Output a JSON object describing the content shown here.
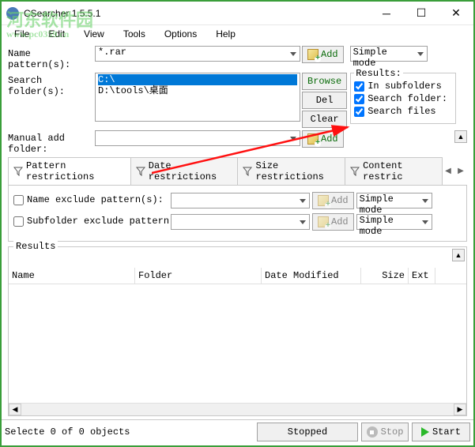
{
  "window": {
    "title": "CSearcher 1.5.5.1"
  },
  "menu": {
    "file": "File",
    "edit": "Edit",
    "view": "View",
    "tools": "Tools",
    "options": "Options",
    "help": "Help"
  },
  "watermark": {
    "line1": "河东软件园",
    "line2": "www.pc0359.cn"
  },
  "form": {
    "name_pattern_label": "Name pattern(s):",
    "name_pattern_value": "*.rar",
    "add_label": "Add",
    "simple_mode": "Simple mode",
    "search_folder_label": "Search folder(s):",
    "folders": [
      "C:\\",
      "D:\\tools\\桌面"
    ],
    "browse": "Browse",
    "del": "Del",
    "clear": "Clear",
    "manual_label": "Manual add folder:",
    "results_title": "Results:",
    "in_subfolders": "In subfolders",
    "search_folders": "Search folder:",
    "search_files": "Search files"
  },
  "tabs": {
    "pattern": "Pattern restrictions",
    "date": "Date restrictions",
    "size": "Size restrictions",
    "content": "Content restric"
  },
  "pattern_panel": {
    "name_exclude": "Name exclude pattern(s):",
    "subfolder_exclude": "Subfolder exclude pattern(s):",
    "add": "Add",
    "simple_mode": "Simple mode"
  },
  "results": {
    "label": "Results",
    "columns": {
      "name": "Name",
      "folder": "Folder",
      "date_modified": "Date Modified",
      "size": "Size",
      "ext": "Ext"
    }
  },
  "status": {
    "text": "Selecte 0 of 0 objects",
    "stopped": "Stopped",
    "stop": "Stop",
    "start": "Start"
  }
}
